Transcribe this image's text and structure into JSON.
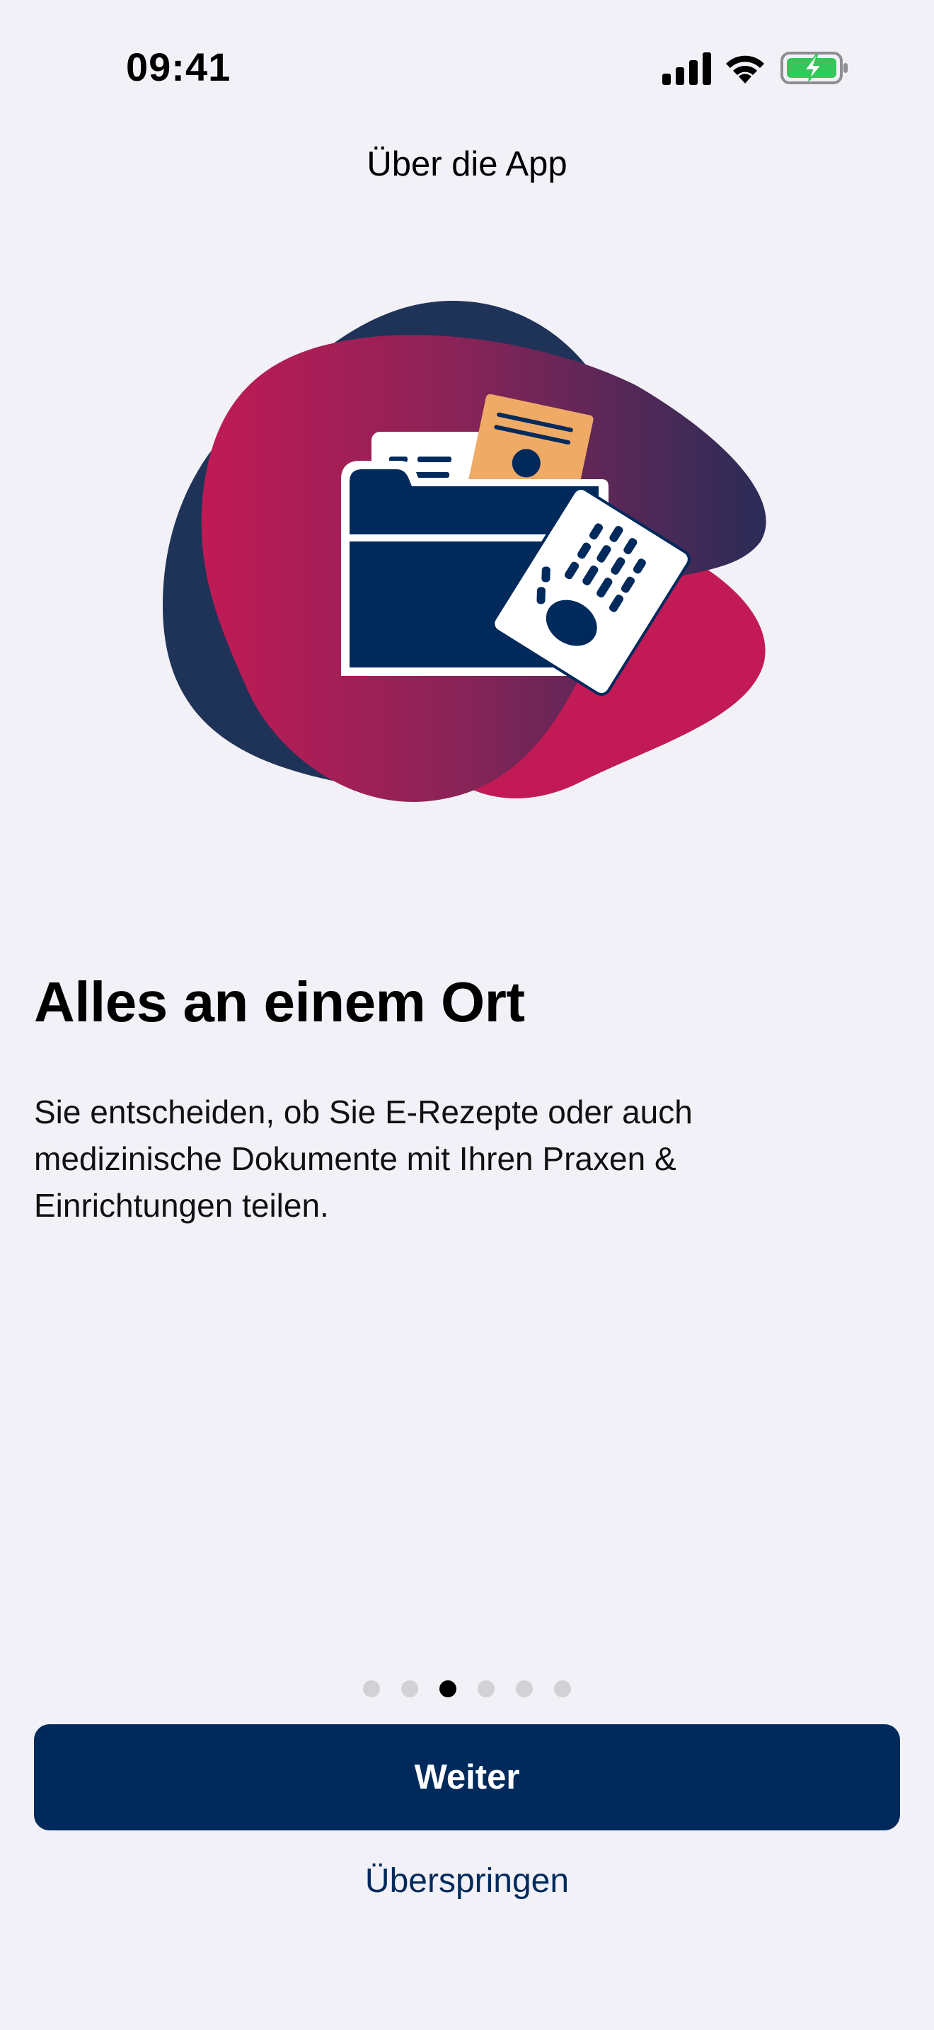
{
  "status_bar": {
    "time": "09:41",
    "icons": [
      "cellular-signal-icon",
      "wifi-icon",
      "battery-charging-icon"
    ],
    "battery_color": "#34c759"
  },
  "nav": {
    "title": "Über die App"
  },
  "illustration": {
    "icons": [
      "folder-icon",
      "document-icon",
      "id-card-icon",
      "xray-hand-icon"
    ],
    "colors": {
      "navy": "#1f3358",
      "crimson": "#c11a55",
      "folder": "#002a5c",
      "card_orange": "#efaa66"
    }
  },
  "content": {
    "headline": "Alles an einem Ort",
    "body": "Sie entscheiden, ob Sie E-Rezepte oder auch medizinische Dokumente mit Ihren Praxen & Einrichtungen teilen."
  },
  "pager": {
    "total": 6,
    "current": 3
  },
  "actions": {
    "primary_label": "Weiter",
    "secondary_label": "Überspringen",
    "accent": "#002a5c"
  }
}
